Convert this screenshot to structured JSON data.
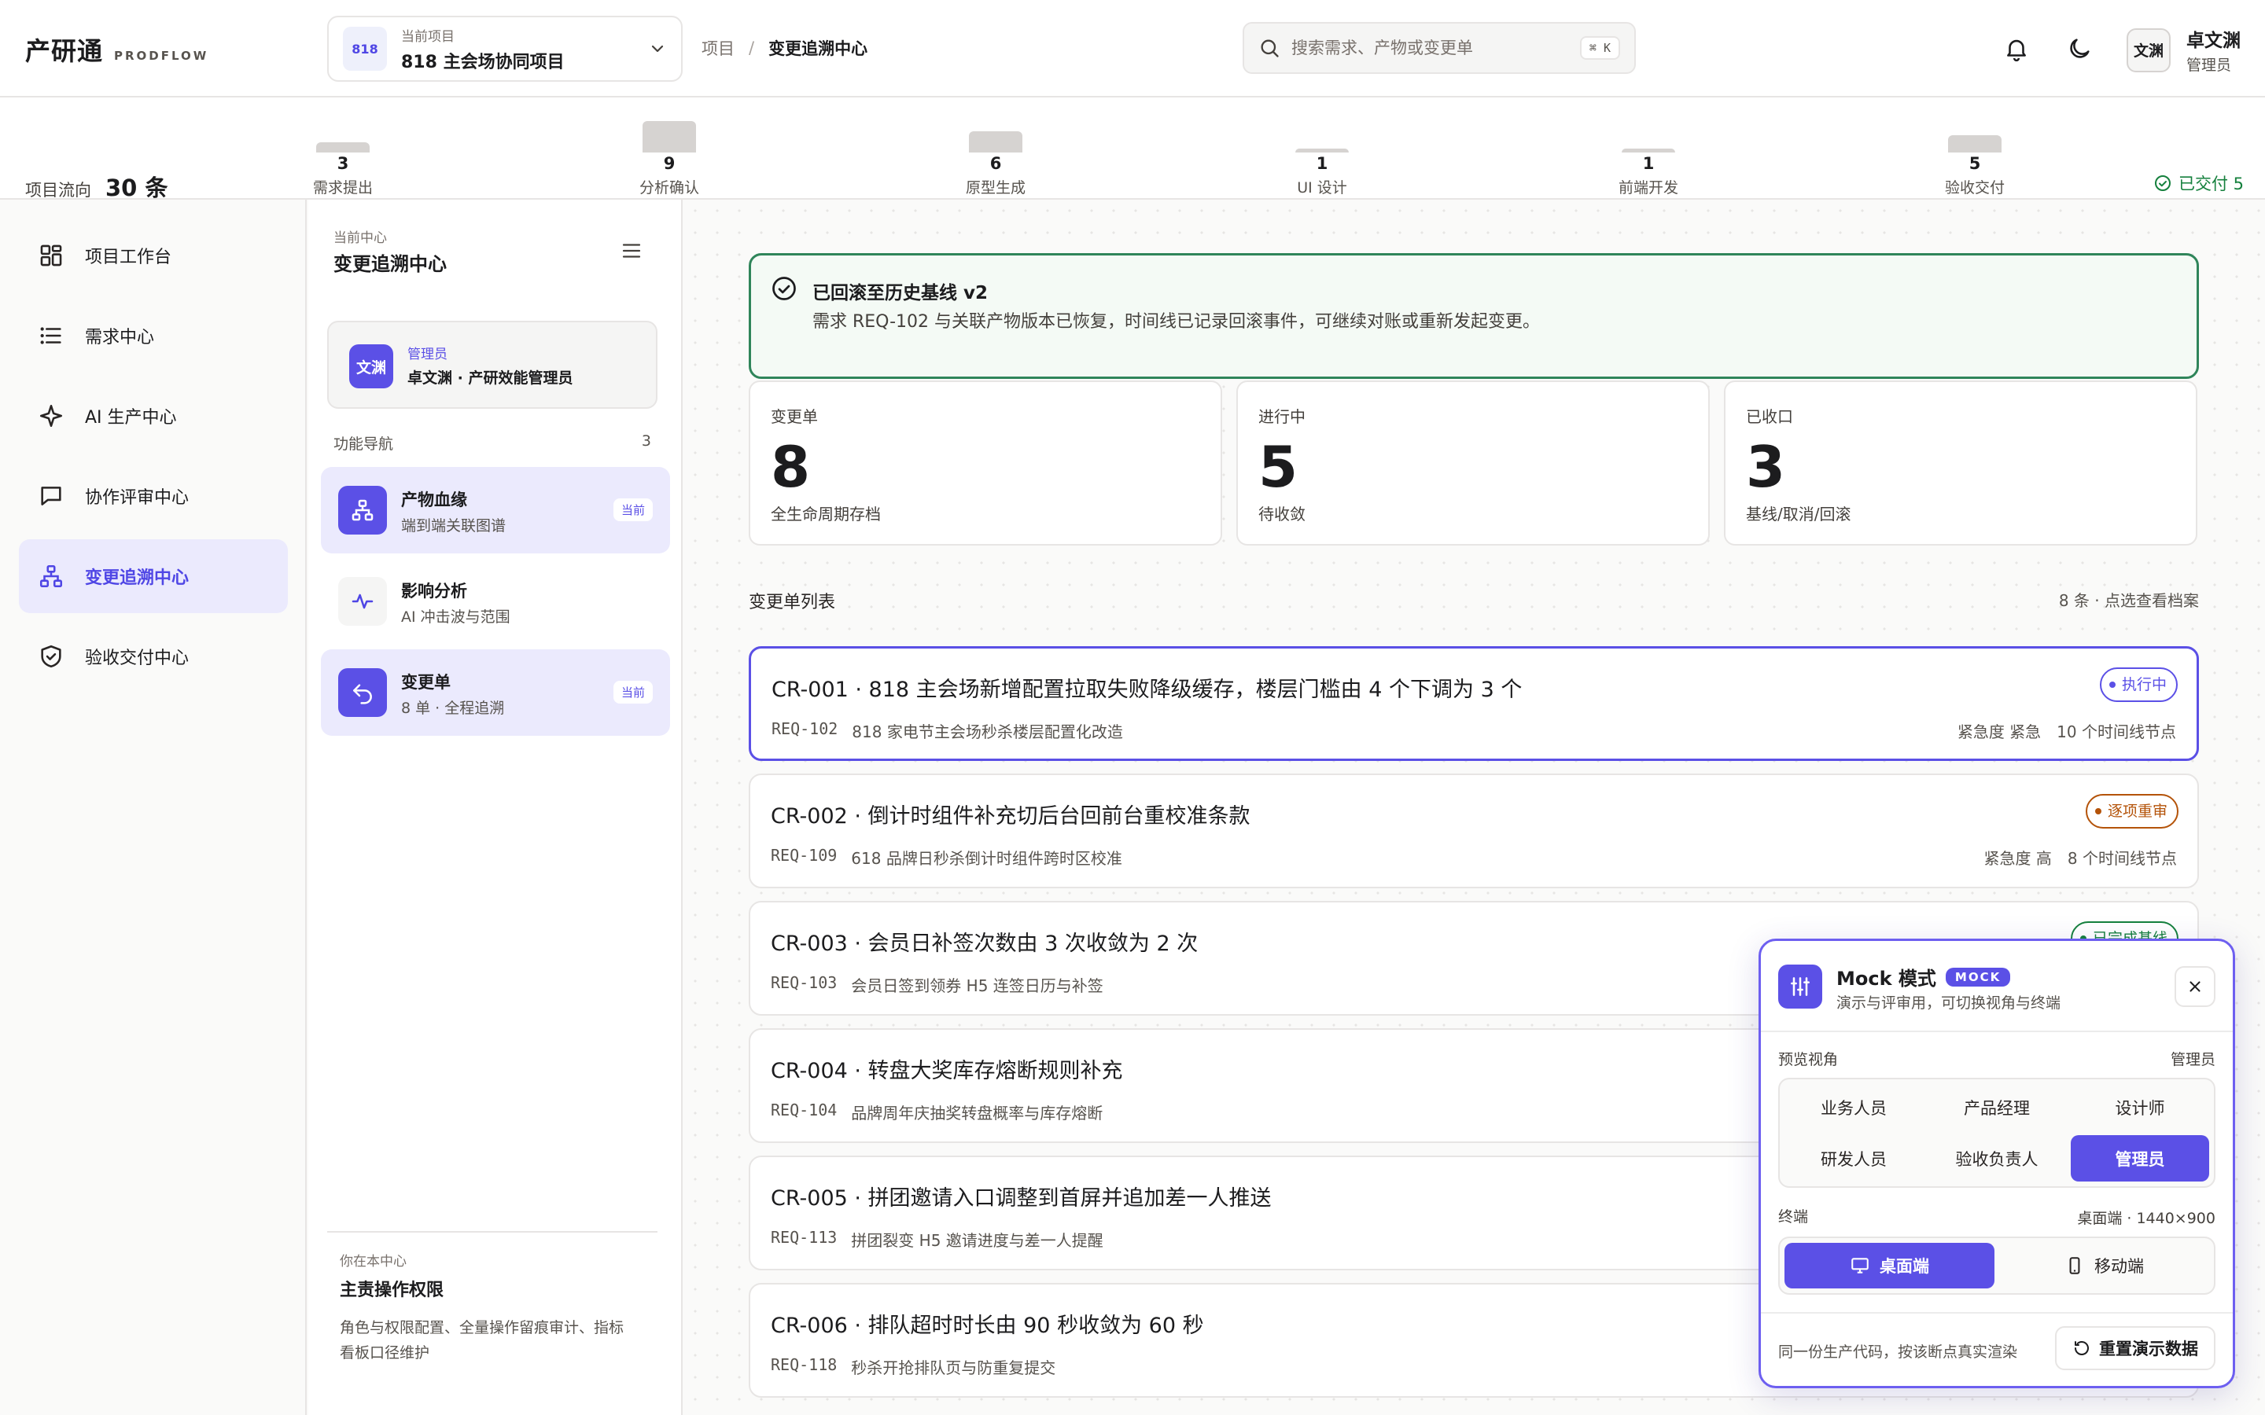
{
  "brand": {
    "name": "产研通",
    "sub": "PRODFLOW"
  },
  "project": {
    "caption": "当前项目",
    "badge": "818",
    "name": "818 主会场协同项目"
  },
  "breadcrumb": {
    "root": "项目",
    "separator": "/",
    "current": "变更追溯中心"
  },
  "search": {
    "placeholder": "搜索需求、产物或变更单",
    "shortcut": "⌘ K"
  },
  "user": {
    "avatar": "文渊",
    "name": "卓文渊",
    "role": "管理员"
  },
  "flow": {
    "total_label": "项目流向",
    "total_value": "30 条",
    "stages": [
      {
        "label": "需求提出",
        "count": "3",
        "level": 3
      },
      {
        "label": "分析确认",
        "count": "9",
        "level": 9
      },
      {
        "label": "原型生成",
        "count": "6",
        "level": 6
      },
      {
        "label": "UI 设计",
        "count": "1",
        "level": 1
      },
      {
        "label": "前端开发",
        "count": "1",
        "level": 1
      },
      {
        "label": "验收交付",
        "count": "5",
        "level": 5
      }
    ],
    "delivered": "已交付 5"
  },
  "sidebar": {
    "items": [
      {
        "label": "项目工作台",
        "icon": "grid-icon"
      },
      {
        "label": "需求中心",
        "icon": "list-icon"
      },
      {
        "label": "AI 生产中心",
        "icon": "sparkle-icon"
      },
      {
        "label": "协作评审中心",
        "icon": "chat-icon"
      },
      {
        "label": "变更追溯中心",
        "icon": "network-icon"
      },
      {
        "label": "验收交付中心",
        "icon": "shield-icon"
      }
    ]
  },
  "panel": {
    "caption": "当前中心",
    "title": "变更追溯中心",
    "user_avatar": "文渊",
    "user_role": "管理员",
    "user_name": "卓文渊 · 产研效能管理员",
    "section_label": "功能导航",
    "section_count": "3",
    "functions": [
      {
        "title": "产物血缘",
        "sub": "端到端关联图谱",
        "tag": "当前"
      },
      {
        "title": "影响分析",
        "sub": "AI 冲击波与范围",
        "tag": ""
      },
      {
        "title": "变更单",
        "sub": "8 单 · 全程追溯",
        "tag": "当前"
      }
    ],
    "footer_caption": "你在本中心",
    "footer_title": "主责操作权限",
    "footer_desc": "角色与权限配置、全量操作留痕审计、指标看板口径维护"
  },
  "alert": {
    "title": "已回滚至历史基线 v2",
    "text": "需求 REQ-102 与关联产物版本已恢复，时间线已记录回滚事件，可继续对账或重新发起变更。"
  },
  "stats": [
    {
      "label": "变更单",
      "value": "8",
      "sub": "全生命周期存档"
    },
    {
      "label": "进行中",
      "value": "5",
      "sub": "待收敛"
    },
    {
      "label": "已收口",
      "value": "3",
      "sub": "基线/取消/回滚"
    }
  ],
  "list": {
    "title": "变更单列表",
    "meta": "8 条 · 点选查看档案",
    "items": [
      {
        "title": "CR-001 · 818 主会场新增配置拉取失败降级缓存，楼层门槛由 4 个下调为 3 个",
        "req": "REQ-102",
        "req_desc": "818 家电节主会场秒杀楼层配置化改造",
        "meta": "紧急度 紧急　10 个时间线节点",
        "status": "执行中",
        "status_color": "#5b50e6"
      },
      {
        "title": "CR-002 · 倒计时组件补充切后台回前台重校准条款",
        "req": "REQ-109",
        "req_desc": "618 品牌日秒杀倒计时组件跨时区校准",
        "meta": "紧急度 高　8 个时间线节点",
        "status": "逐项重审",
        "status_color": "#b45309"
      },
      {
        "title": "CR-003 · 会员日补签次数由 3 次收敛为 2 次",
        "req": "REQ-103",
        "req_desc": "会员日签到领券 H5 连签日历与补签",
        "meta": "",
        "status": "已完成基线",
        "status_color": "#15803d"
      },
      {
        "title": "CR-004 · 转盘大奖库存熔断规则补充",
        "req": "REQ-104",
        "req_desc": "品牌周年庆抽奖转盘概率与库存熔断",
        "meta": "",
        "status": "",
        "status_color": ""
      },
      {
        "title": "CR-005 · 拼团邀请入口调整到首屏并追加差一人推送",
        "req": "REQ-113",
        "req_desc": "拼团裂变 H5 邀请进度与差一人提醒",
        "meta": "",
        "status": "",
        "status_color": ""
      },
      {
        "title": "CR-006 · 排队超时时长由 90 秒收敛为 60 秒",
        "req": "REQ-118",
        "req_desc": "秒杀开抢排队页与防重复提交",
        "meta": "",
        "status": "",
        "status_color": ""
      }
    ]
  },
  "mock": {
    "title": "Mock 模式",
    "badge": "MOCK",
    "sub": "演示与评审用，可切换视角与终端",
    "view_label": "预览视角",
    "view_current": "管理员",
    "roles": [
      "业务人员",
      "产品经理",
      "设计师",
      "研发人员",
      "验收负责人",
      "管理员"
    ],
    "active_role": 5,
    "device_label": "终端",
    "device_current": "桌面端 · 1440×900",
    "devices": [
      "桌面端",
      "移动端"
    ],
    "footer": "同一份生产代码，按该断点真实渲染",
    "reset": "重置演示数据"
  },
  "colors": {
    "accent": "#5b50e6",
    "success": "#2f855a",
    "warning": "#b45309"
  }
}
